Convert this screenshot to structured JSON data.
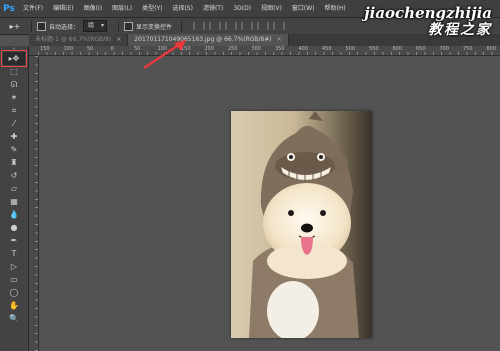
{
  "app": {
    "logo": "Ps"
  },
  "menu": [
    "文件(F)",
    "编辑(E)",
    "图像(I)",
    "图层(L)",
    "类型(Y)",
    "选择(S)",
    "滤镜(T)",
    "3D(D)",
    "视图(V)",
    "窗口(W)",
    "帮助(H)"
  ],
  "options": {
    "tool_preset_glyph": "▸+",
    "auto_select_label": "自动选择：",
    "auto_select_value": "组",
    "transform_label": "显示变换控件"
  },
  "tabs": [
    {
      "label": "未标题-1 @ 66.7%(RGB/8)",
      "close": "×"
    },
    {
      "label": "201701171049065163.jpg @ 66.7%(RGB/8#)",
      "close": "×"
    }
  ],
  "ruler": {
    "h_labels": [
      "150",
      "100",
      "50",
      "0",
      "50",
      "100",
      "150",
      "200",
      "250",
      "300",
      "350",
      "400",
      "450",
      "500",
      "550",
      "600",
      "650",
      "700",
      "750",
      "800"
    ]
  },
  "tools": [
    {
      "name": "move-tool",
      "glyph": "▸✥"
    },
    {
      "name": "marquee-tool",
      "glyph": "⬚"
    },
    {
      "name": "lasso-tool",
      "glyph": "ᘏ"
    },
    {
      "name": "magic-wand-tool",
      "glyph": "✶"
    },
    {
      "name": "crop-tool",
      "glyph": "⌗"
    },
    {
      "name": "eyedropper-tool",
      "glyph": "⁄"
    },
    {
      "name": "healing-brush-tool",
      "glyph": "✚"
    },
    {
      "name": "brush-tool",
      "glyph": "✎"
    },
    {
      "name": "clone-stamp-tool",
      "glyph": "♜"
    },
    {
      "name": "history-brush-tool",
      "glyph": "↺"
    },
    {
      "name": "eraser-tool",
      "glyph": "▱"
    },
    {
      "name": "gradient-tool",
      "glyph": "▦"
    },
    {
      "name": "blur-tool",
      "glyph": "💧"
    },
    {
      "name": "dodge-tool",
      "glyph": "●"
    },
    {
      "name": "pen-tool",
      "glyph": "✒"
    },
    {
      "name": "type-tool",
      "glyph": "T"
    },
    {
      "name": "path-selection-tool",
      "glyph": "▷"
    },
    {
      "name": "shape-tool",
      "glyph": "▭"
    },
    {
      "name": "ellipse-tool",
      "glyph": "◯"
    },
    {
      "name": "hand-tool",
      "glyph": "✋"
    },
    {
      "name": "zoom-tool",
      "glyph": "🔍"
    }
  ],
  "watermark": {
    "line1": "jiaochengzhijia",
    "line2": "教程之家"
  },
  "colors": {
    "highlight": "#e84b4b",
    "arrow": "#e8383d",
    "ps_blue": "#31a8ff"
  }
}
